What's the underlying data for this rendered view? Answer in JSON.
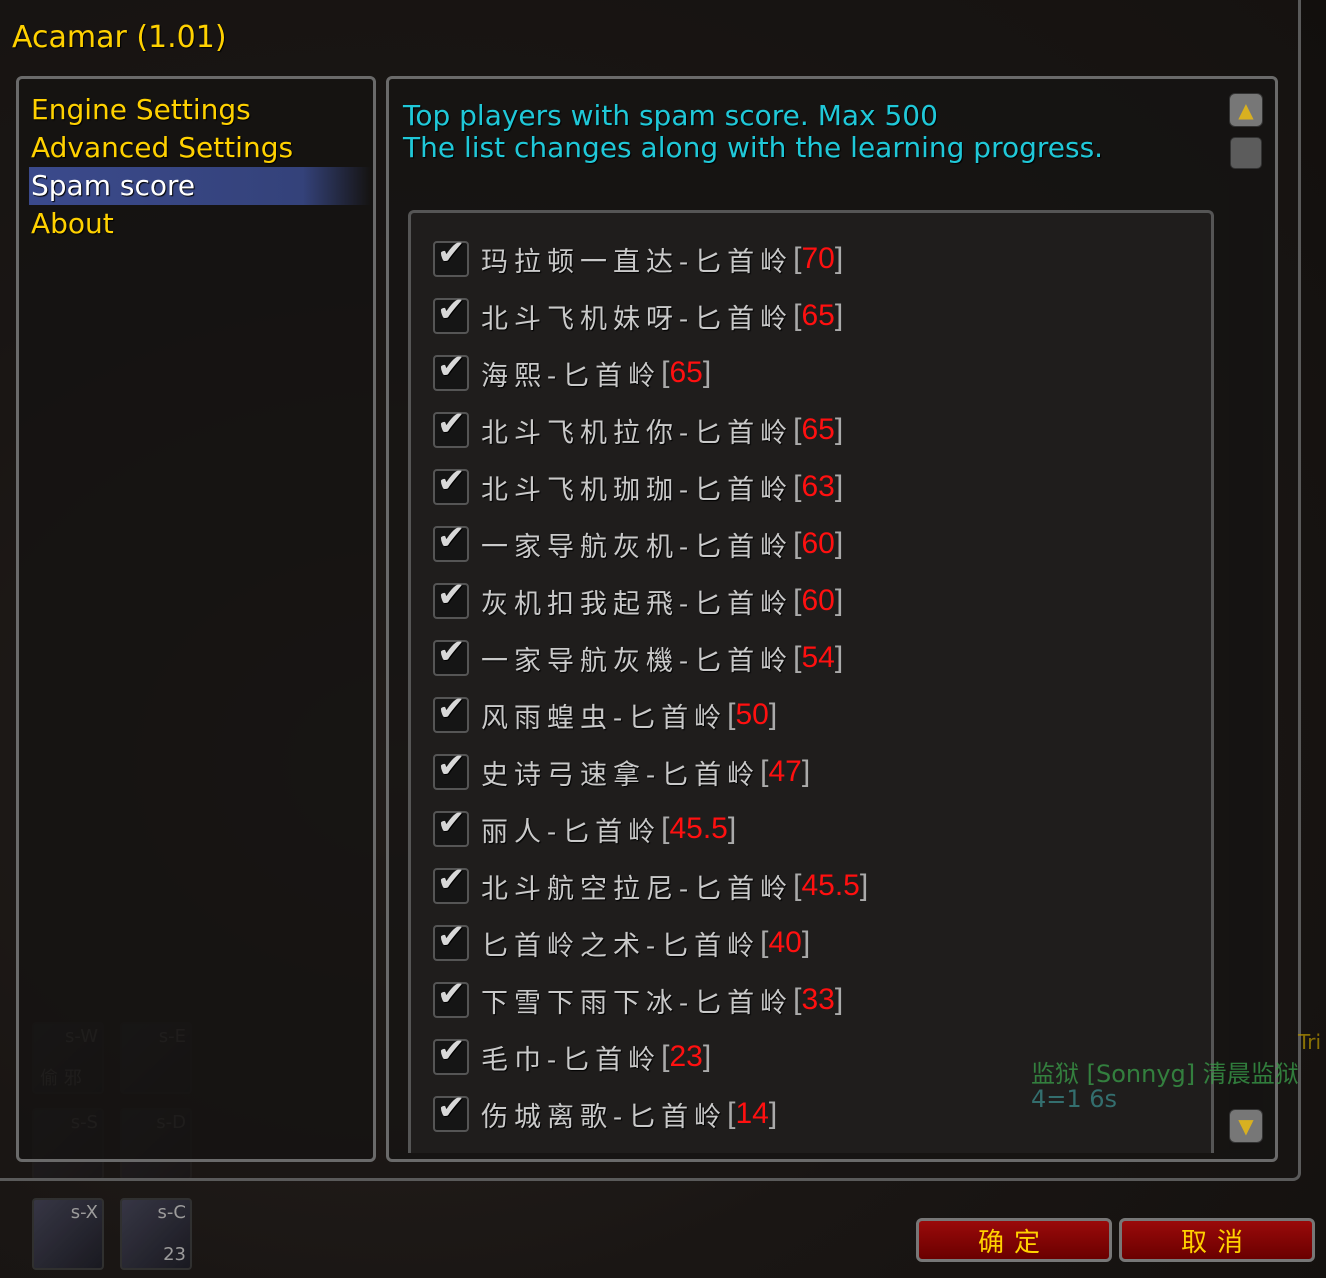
{
  "window": {
    "title": "Acamar (1.01)"
  },
  "sidebar": {
    "items": [
      {
        "label": "Engine Settings",
        "selected": false
      },
      {
        "label": "Advanced Settings",
        "selected": false
      },
      {
        "label": "Spam score",
        "selected": true
      },
      {
        "label": "About",
        "selected": false
      }
    ]
  },
  "main": {
    "description_line1": "Top players with spam score. Max 500",
    "description_line2": "The list changes along with the learning progress.",
    "players": [
      {
        "name": "玛拉顿一直达-匕首岭",
        "score": "70",
        "checked": true
      },
      {
        "name": "北斗飞机妹呀-匕首岭",
        "score": "65",
        "checked": true
      },
      {
        "name": "海熙-匕首岭",
        "score": "65",
        "checked": true
      },
      {
        "name": "北斗飞机拉你-匕首岭",
        "score": "65",
        "checked": true
      },
      {
        "name": "北斗飞机珈珈-匕首岭",
        "score": "63",
        "checked": true
      },
      {
        "name": "一家导航灰机-匕首岭",
        "score": "60",
        "checked": true
      },
      {
        "name": "灰机扣我起飛-匕首岭",
        "score": "60",
        "checked": true
      },
      {
        "name": "一家导航灰機-匕首岭",
        "score": "54",
        "checked": true
      },
      {
        "name": "风雨蝗虫-匕首岭",
        "score": "50",
        "checked": true
      },
      {
        "name": "史诗弓速拿-匕首岭",
        "score": "47",
        "checked": true
      },
      {
        "name": "丽人-匕首岭",
        "score": "45.5",
        "checked": true
      },
      {
        "name": "北斗航空拉尼-匕首岭",
        "score": "45.5",
        "checked": true
      },
      {
        "name": "匕首岭之术-匕首岭",
        "score": "40",
        "checked": true
      },
      {
        "name": "下雪下雨下冰-匕首岭",
        "score": "33",
        "checked": true
      },
      {
        "name": "毛巾-匕首岭",
        "score": "23",
        "checked": true
      },
      {
        "name": "伤城离歌-匕首岭",
        "score": "14",
        "checked": true
      }
    ]
  },
  "buttons": {
    "ok": "确定",
    "cancel": "取消"
  },
  "background": {
    "chat_line": "监狱 [Sonnyg] 清晨监狱",
    "chat_sub": "4=1    6s",
    "corner_text": "Tri",
    "action_slots": [
      {
        "key": "s-W",
        "label": "偷 邪"
      },
      {
        "key": "s-E",
        "label": ""
      },
      {
        "key": "s-S",
        "label": ""
      },
      {
        "key": "s-D",
        "label": ""
      },
      {
        "key": "s-X",
        "label": ""
      },
      {
        "key": "s-C",
        "label": "23"
      }
    ]
  },
  "colors": {
    "title": "#ffd100",
    "description": "#20c8d8",
    "score": "#ff1010",
    "selected_bg": "#3b4a8c"
  }
}
